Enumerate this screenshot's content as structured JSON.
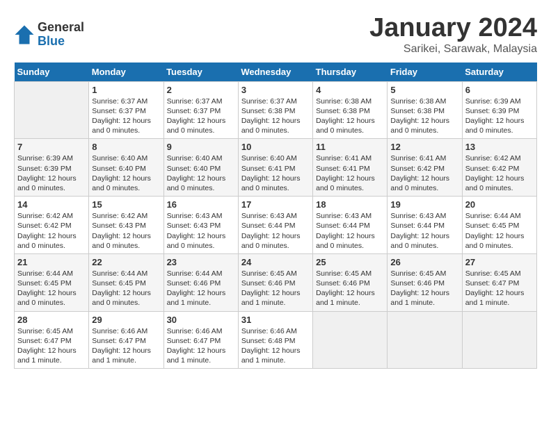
{
  "logo": {
    "general": "General",
    "blue": "Blue"
  },
  "title": "January 2024",
  "subtitle": "Sarikei, Sarawak, Malaysia",
  "days_of_week": [
    "Sunday",
    "Monday",
    "Tuesday",
    "Wednesday",
    "Thursday",
    "Friday",
    "Saturday"
  ],
  "weeks": [
    [
      {
        "day": "",
        "info": ""
      },
      {
        "day": "1",
        "info": "Sunrise: 6:37 AM\nSunset: 6:37 PM\nDaylight: 12 hours\nand 0 minutes."
      },
      {
        "day": "2",
        "info": "Sunrise: 6:37 AM\nSunset: 6:37 PM\nDaylight: 12 hours\nand 0 minutes."
      },
      {
        "day": "3",
        "info": "Sunrise: 6:37 AM\nSunset: 6:38 PM\nDaylight: 12 hours\nand 0 minutes."
      },
      {
        "day": "4",
        "info": "Sunrise: 6:38 AM\nSunset: 6:38 PM\nDaylight: 12 hours\nand 0 minutes."
      },
      {
        "day": "5",
        "info": "Sunrise: 6:38 AM\nSunset: 6:38 PM\nDaylight: 12 hours\nand 0 minutes."
      },
      {
        "day": "6",
        "info": "Sunrise: 6:39 AM\nSunset: 6:39 PM\nDaylight: 12 hours\nand 0 minutes."
      }
    ],
    [
      {
        "day": "7",
        "info": "Sunrise: 6:39 AM\nSunset: 6:39 PM\nDaylight: 12 hours\nand 0 minutes."
      },
      {
        "day": "8",
        "info": "Sunrise: 6:40 AM\nSunset: 6:40 PM\nDaylight: 12 hours\nand 0 minutes."
      },
      {
        "day": "9",
        "info": "Sunrise: 6:40 AM\nSunset: 6:40 PM\nDaylight: 12 hours\nand 0 minutes."
      },
      {
        "day": "10",
        "info": "Sunrise: 6:40 AM\nSunset: 6:41 PM\nDaylight: 12 hours\nand 0 minutes."
      },
      {
        "day": "11",
        "info": "Sunrise: 6:41 AM\nSunset: 6:41 PM\nDaylight: 12 hours\nand 0 minutes."
      },
      {
        "day": "12",
        "info": "Sunrise: 6:41 AM\nSunset: 6:42 PM\nDaylight: 12 hours\nand 0 minutes."
      },
      {
        "day": "13",
        "info": "Sunrise: 6:42 AM\nSunset: 6:42 PM\nDaylight: 12 hours\nand 0 minutes."
      }
    ],
    [
      {
        "day": "14",
        "info": "Sunrise: 6:42 AM\nSunset: 6:42 PM\nDaylight: 12 hours\nand 0 minutes."
      },
      {
        "day": "15",
        "info": "Sunrise: 6:42 AM\nSunset: 6:43 PM\nDaylight: 12 hours\nand 0 minutes."
      },
      {
        "day": "16",
        "info": "Sunrise: 6:43 AM\nSunset: 6:43 PM\nDaylight: 12 hours\nand 0 minutes."
      },
      {
        "day": "17",
        "info": "Sunrise: 6:43 AM\nSunset: 6:44 PM\nDaylight: 12 hours\nand 0 minutes."
      },
      {
        "day": "18",
        "info": "Sunrise: 6:43 AM\nSunset: 6:44 PM\nDaylight: 12 hours\nand 0 minutes."
      },
      {
        "day": "19",
        "info": "Sunrise: 6:43 AM\nSunset: 6:44 PM\nDaylight: 12 hours\nand 0 minutes."
      },
      {
        "day": "20",
        "info": "Sunrise: 6:44 AM\nSunset: 6:45 PM\nDaylight: 12 hours\nand 0 minutes."
      }
    ],
    [
      {
        "day": "21",
        "info": "Sunrise: 6:44 AM\nSunset: 6:45 PM\nDaylight: 12 hours\nand 0 minutes."
      },
      {
        "day": "22",
        "info": "Sunrise: 6:44 AM\nSunset: 6:45 PM\nDaylight: 12 hours\nand 0 minutes."
      },
      {
        "day": "23",
        "info": "Sunrise: 6:44 AM\nSunset: 6:46 PM\nDaylight: 12 hours\nand 1 minute."
      },
      {
        "day": "24",
        "info": "Sunrise: 6:45 AM\nSunset: 6:46 PM\nDaylight: 12 hours\nand 1 minute."
      },
      {
        "day": "25",
        "info": "Sunrise: 6:45 AM\nSunset: 6:46 PM\nDaylight: 12 hours\nand 1 minute."
      },
      {
        "day": "26",
        "info": "Sunrise: 6:45 AM\nSunset: 6:46 PM\nDaylight: 12 hours\nand 1 minute."
      },
      {
        "day": "27",
        "info": "Sunrise: 6:45 AM\nSunset: 6:47 PM\nDaylight: 12 hours\nand 1 minute."
      }
    ],
    [
      {
        "day": "28",
        "info": "Sunrise: 6:45 AM\nSunset: 6:47 PM\nDaylight: 12 hours\nand 1 minute."
      },
      {
        "day": "29",
        "info": "Sunrise: 6:46 AM\nSunset: 6:47 PM\nDaylight: 12 hours\nand 1 minute."
      },
      {
        "day": "30",
        "info": "Sunrise: 6:46 AM\nSunset: 6:47 PM\nDaylight: 12 hours\nand 1 minute."
      },
      {
        "day": "31",
        "info": "Sunrise: 6:46 AM\nSunset: 6:48 PM\nDaylight: 12 hours\nand 1 minute."
      },
      {
        "day": "",
        "info": ""
      },
      {
        "day": "",
        "info": ""
      },
      {
        "day": "",
        "info": ""
      }
    ]
  ]
}
